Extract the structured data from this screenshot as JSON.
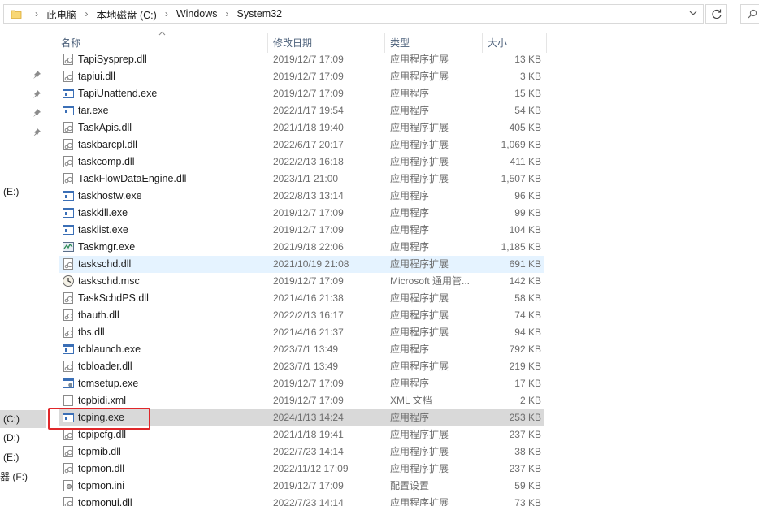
{
  "address_bar": {
    "breadcrumbs": [
      "此电脑",
      "本地磁盘 (C:)",
      "Windows",
      "System32"
    ],
    "separator": "›"
  },
  "nav_pane": {
    "drives": [
      {
        "label": "(E:)"
      },
      {
        "label": "(C:)",
        "selected": true
      },
      {
        "label": "(D:)"
      },
      {
        "label": "(E:)"
      },
      {
        "label": "器 (F:)"
      }
    ]
  },
  "columns": {
    "name": "名称",
    "modified": "修改日期",
    "type": "类型",
    "size": "大小"
  },
  "files": [
    {
      "name": "TapiSysprep.dll",
      "modified": "2019/12/7 17:09",
      "type": "应用程序扩展",
      "size": "13 KB",
      "icon": "dll-file-icon"
    },
    {
      "name": "tapiui.dll",
      "modified": "2019/12/7 17:09",
      "type": "应用程序扩展",
      "size": "3 KB",
      "icon": "dll-file-icon"
    },
    {
      "name": "TapiUnattend.exe",
      "modified": "2019/12/7 17:09",
      "type": "应用程序",
      "size": "15 KB",
      "icon": "exe-file-icon"
    },
    {
      "name": "tar.exe",
      "modified": "2022/1/17 19:54",
      "type": "应用程序",
      "size": "54 KB",
      "icon": "exe-file-icon"
    },
    {
      "name": "TaskApis.dll",
      "modified": "2021/1/18 19:40",
      "type": "应用程序扩展",
      "size": "405 KB",
      "icon": "dll-file-icon"
    },
    {
      "name": "taskbarcpl.dll",
      "modified": "2022/6/17 20:17",
      "type": "应用程序扩展",
      "size": "1,069 KB",
      "icon": "dll-file-icon"
    },
    {
      "name": "taskcomp.dll",
      "modified": "2022/2/13 16:18",
      "type": "应用程序扩展",
      "size": "411 KB",
      "icon": "dll-file-icon"
    },
    {
      "name": "TaskFlowDataEngine.dll",
      "modified": "2023/1/1 21:00",
      "type": "应用程序扩展",
      "size": "1,507 KB",
      "icon": "dll-file-icon"
    },
    {
      "name": "taskhostw.exe",
      "modified": "2022/8/13 13:14",
      "type": "应用程序",
      "size": "96 KB",
      "icon": "exe-file-icon"
    },
    {
      "name": "taskkill.exe",
      "modified": "2019/12/7 17:09",
      "type": "应用程序",
      "size": "99 KB",
      "icon": "exe-file-icon"
    },
    {
      "name": "tasklist.exe",
      "modified": "2019/12/7 17:09",
      "type": "应用程序",
      "size": "104 KB",
      "icon": "exe-file-icon"
    },
    {
      "name": "Taskmgr.exe",
      "modified": "2021/9/18 22:06",
      "type": "应用程序",
      "size": "1,185 KB",
      "icon": "taskmgr-icon"
    },
    {
      "name": "taskschd.dll",
      "modified": "2021/10/19 21:08",
      "type": "应用程序扩展",
      "size": "691 KB",
      "icon": "dll-file-icon",
      "state": "hover"
    },
    {
      "name": "taskschd.msc",
      "modified": "2019/12/7 17:09",
      "type": "Microsoft 通用管...",
      "size": "142 KB",
      "icon": "clock-icon"
    },
    {
      "name": "TaskSchdPS.dll",
      "modified": "2021/4/16 21:38",
      "type": "应用程序扩展",
      "size": "58 KB",
      "icon": "dll-file-icon"
    },
    {
      "name": "tbauth.dll",
      "modified": "2022/2/13 16:17",
      "type": "应用程序扩展",
      "size": "74 KB",
      "icon": "dll-file-icon"
    },
    {
      "name": "tbs.dll",
      "modified": "2021/4/16 21:37",
      "type": "应用程序扩展",
      "size": "94 KB",
      "icon": "dll-file-icon"
    },
    {
      "name": "tcblaunch.exe",
      "modified": "2023/7/1 13:49",
      "type": "应用程序",
      "size": "792 KB",
      "icon": "exe-file-icon"
    },
    {
      "name": "tcbloader.dll",
      "modified": "2023/7/1 13:49",
      "type": "应用程序扩展",
      "size": "219 KB",
      "icon": "dll-file-icon"
    },
    {
      "name": "tcmsetup.exe",
      "modified": "2019/12/7 17:09",
      "type": "应用程序",
      "size": "17 KB",
      "icon": "setup-exe-icon"
    },
    {
      "name": "tcpbidi.xml",
      "modified": "2019/12/7 17:09",
      "type": "XML 文档",
      "size": "2 KB",
      "icon": "xml-file-icon"
    },
    {
      "name": "tcping.exe",
      "modified": "2024/1/13 14:24",
      "type": "应用程序",
      "size": "253 KB",
      "icon": "exe-file-icon",
      "state": "selected"
    },
    {
      "name": "tcpipcfg.dll",
      "modified": "2021/1/18 19:41",
      "type": "应用程序扩展",
      "size": "237 KB",
      "icon": "dll-file-icon"
    },
    {
      "name": "tcpmib.dll",
      "modified": "2022/7/23 14:14",
      "type": "应用程序扩展",
      "size": "38 KB",
      "icon": "dll-file-icon"
    },
    {
      "name": "tcpmon.dll",
      "modified": "2022/11/12 17:09",
      "type": "应用程序扩展",
      "size": "237 KB",
      "icon": "dll-file-icon"
    },
    {
      "name": "tcpmon.ini",
      "modified": "2019/12/7 17:09",
      "type": "配置设置",
      "size": "59 KB",
      "icon": "ini-file-icon"
    },
    {
      "name": "tcpmonui.dll",
      "modified": "2022/7/23 14:14",
      "type": "应用程序扩展",
      "size": "73 KB",
      "icon": "dll-file-icon"
    }
  ],
  "colors": {
    "hover_row": "#e5f3ff",
    "selected_row": "#d9d9d9",
    "annotation_box": "#e0272a",
    "header_text": "#4c607a"
  }
}
